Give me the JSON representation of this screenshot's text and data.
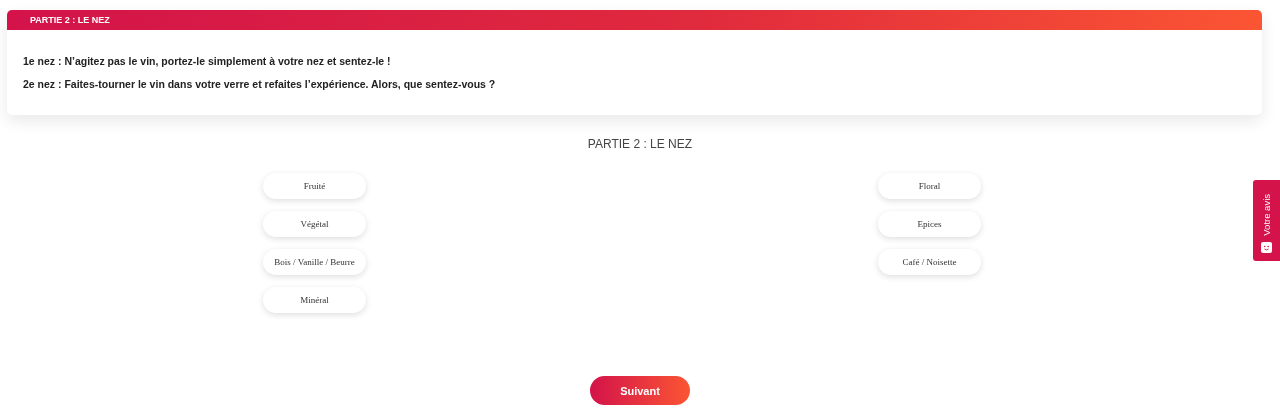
{
  "card": {
    "header": "PARTIE 2 : LE NEZ",
    "paragraphs": [
      {
        "lead": "1e nez :",
        "text": "N’agitez pas le vin, portez-le simplement à votre nez et sentez-le !"
      },
      {
        "lead": "2e nez :",
        "text": "Faites-tourner le vin dans votre verre et refaites l’expérience. Alors, que sentez-vous ?"
      }
    ]
  },
  "section_title": "PARTIE 2 : LE NEZ",
  "options": {
    "left": [
      "Fruité",
      "Végétal",
      "Bois / Vanille / Beurre",
      "Minéral"
    ],
    "right": [
      "Floral",
      "Epices",
      "Café / Noisette"
    ]
  },
  "next_button": "Suivant",
  "feedback_tab": "Votre avis"
}
